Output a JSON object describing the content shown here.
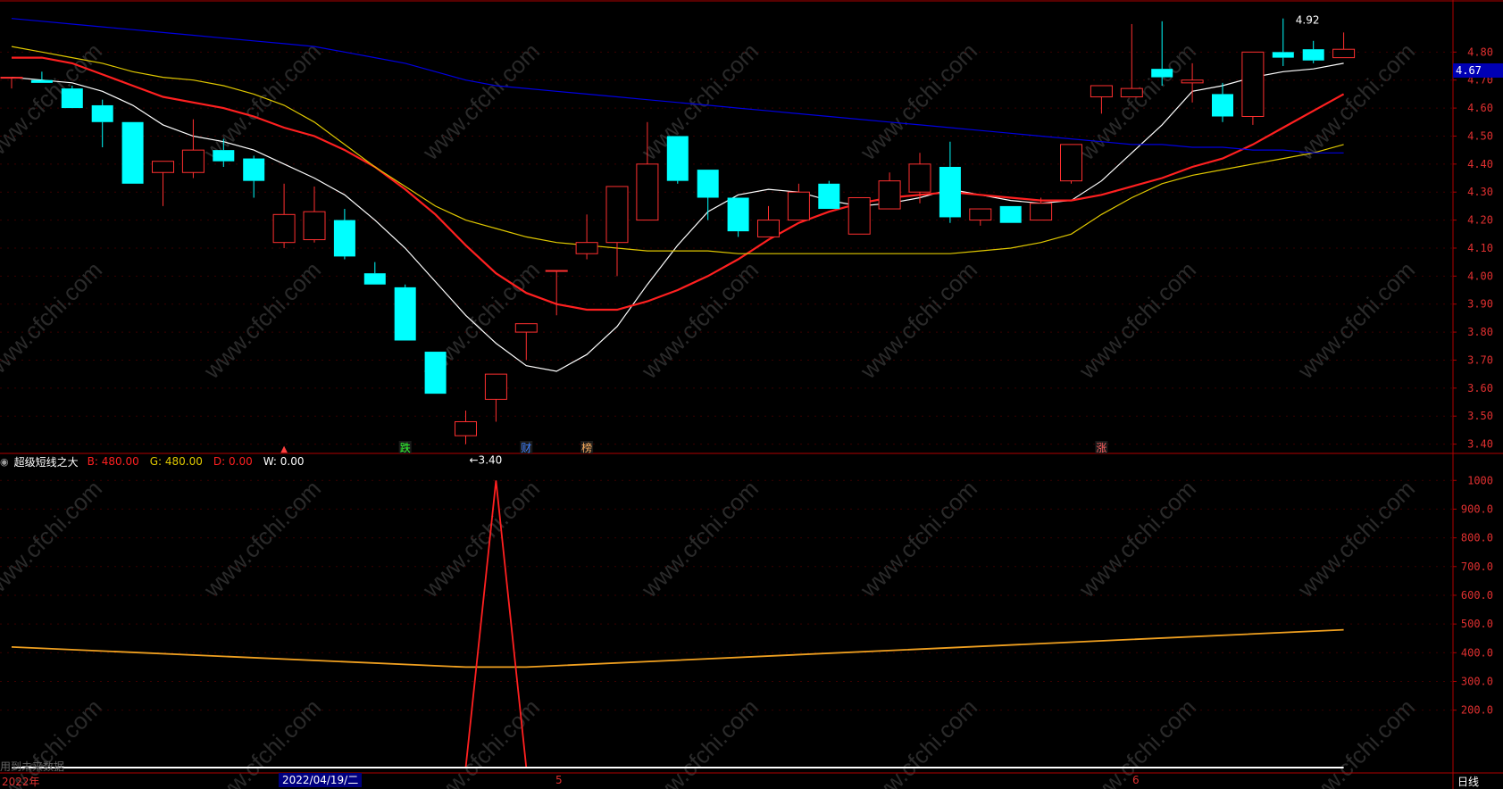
{
  "chart_data": [
    {
      "type": "candlestick",
      "title": "",
      "price_axis": {
        "ticks": [
          "4.80",
          "4.70",
          "4.60",
          "4.50",
          "4.40",
          "4.30",
          "4.20",
          "4.10",
          "4.00",
          "3.90",
          "3.80",
          "3.70",
          "3.60",
          "3.50",
          "3.40"
        ],
        "ylim": [
          3.37,
          4.97
        ]
      },
      "candles": [
        {
          "o": 4.71,
          "h": 4.71,
          "l": 4.67,
          "c": 4.71
        },
        {
          "o": 4.7,
          "h": 4.73,
          "l": 4.69,
          "c": 4.69
        },
        {
          "o": 4.67,
          "h": 4.68,
          "l": 4.6,
          "c": 4.6
        },
        {
          "o": 4.61,
          "h": 4.63,
          "l": 4.46,
          "c": 4.55
        },
        {
          "o": 4.55,
          "h": 4.55,
          "l": 4.33,
          "c": 4.33
        },
        {
          "o": 4.37,
          "h": 4.41,
          "l": 4.25,
          "c": 4.41
        },
        {
          "o": 4.37,
          "h": 4.56,
          "l": 4.35,
          "c": 4.45
        },
        {
          "o": 4.45,
          "h": 4.49,
          "l": 4.39,
          "c": 4.41
        },
        {
          "o": 4.42,
          "h": 4.43,
          "l": 4.28,
          "c": 4.34
        },
        {
          "o": 4.12,
          "h": 4.33,
          "l": 4.1,
          "c": 4.22
        },
        {
          "o": 4.13,
          "h": 4.32,
          "l": 4.12,
          "c": 4.23
        },
        {
          "o": 4.2,
          "h": 4.24,
          "l": 4.06,
          "c": 4.07
        },
        {
          "o": 4.01,
          "h": 4.05,
          "l": 3.97,
          "c": 3.97
        },
        {
          "o": 3.96,
          "h": 3.97,
          "l": 3.77,
          "c": 3.77
        },
        {
          "o": 3.73,
          "h": 3.73,
          "l": 3.58,
          "c": 3.58
        },
        {
          "o": 3.43,
          "h": 3.52,
          "l": 3.4,
          "c": 3.48
        },
        {
          "o": 3.56,
          "h": 3.65,
          "l": 3.48,
          "c": 3.65
        },
        {
          "o": 3.8,
          "h": 3.83,
          "l": 3.7,
          "c": 3.83
        },
        {
          "o": 4.02,
          "h": 4.02,
          "l": 3.86,
          "c": 4.02
        },
        {
          "o": 4.08,
          "h": 4.22,
          "l": 4.06,
          "c": 4.12
        },
        {
          "o": 4.12,
          "h": 4.32,
          "l": 4.0,
          "c": 4.32
        },
        {
          "o": 4.2,
          "h": 4.55,
          "l": 4.2,
          "c": 4.4
        },
        {
          "o": 4.5,
          "h": 4.5,
          "l": 4.33,
          "c": 4.34
        },
        {
          "o": 4.38,
          "h": 4.38,
          "l": 4.2,
          "c": 4.28
        },
        {
          "o": 4.28,
          "h": 4.28,
          "l": 4.14,
          "c": 4.16
        },
        {
          "o": 4.14,
          "h": 4.25,
          "l": 4.14,
          "c": 4.2
        },
        {
          "o": 4.2,
          "h": 4.33,
          "l": 4.2,
          "c": 4.3
        },
        {
          "o": 4.33,
          "h": 4.34,
          "l": 4.24,
          "c": 4.24
        },
        {
          "o": 4.15,
          "h": 4.28,
          "l": 4.15,
          "c": 4.28
        },
        {
          "o": 4.24,
          "h": 4.37,
          "l": 4.24,
          "c": 4.34
        },
        {
          "o": 4.3,
          "h": 4.44,
          "l": 4.26,
          "c": 4.4
        },
        {
          "o": 4.39,
          "h": 4.48,
          "l": 4.19,
          "c": 4.21
        },
        {
          "o": 4.2,
          "h": 4.24,
          "l": 4.18,
          "c": 4.24
        },
        {
          "o": 4.25,
          "h": 4.25,
          "l": 4.19,
          "c": 4.19
        },
        {
          "o": 4.2,
          "h": 4.28,
          "l": 4.2,
          "c": 4.26
        },
        {
          "o": 4.34,
          "h": 4.47,
          "l": 4.33,
          "c": 4.47
        },
        {
          "o": 4.64,
          "h": 4.68,
          "l": 4.58,
          "c": 4.68
        },
        {
          "o": 4.64,
          "h": 4.9,
          "l": 4.64,
          "c": 4.67
        },
        {
          "o": 4.74,
          "h": 4.91,
          "l": 4.68,
          "c": 4.71
        },
        {
          "o": 4.69,
          "h": 4.76,
          "l": 4.62,
          "c": 4.7
        },
        {
          "o": 4.65,
          "h": 4.69,
          "l": 4.55,
          "c": 4.57
        },
        {
          "o": 4.57,
          "h": 4.8,
          "l": 4.54,
          "c": 4.8
        },
        {
          "o": 4.8,
          "h": 4.92,
          "l": 4.75,
          "c": 4.78
        },
        {
          "o": 4.81,
          "h": 4.84,
          "l": 4.76,
          "c": 4.77
        },
        {
          "o": 4.78,
          "h": 4.87,
          "l": 4.78,
          "c": 4.81
        }
      ],
      "ma_lines": [
        {
          "color": "#ffffff",
          "values": [
            4.71,
            4.7,
            4.69,
            4.66,
            4.61,
            4.54,
            4.5,
            4.48,
            4.45,
            4.4,
            4.35,
            4.29,
            4.2,
            4.1,
            3.98,
            3.86,
            3.76,
            3.68,
            3.66,
            3.72,
            3.82,
            3.97,
            4.11,
            4.23,
            4.29,
            4.31,
            4.3,
            4.27,
            4.25,
            4.26,
            4.28,
            4.31,
            4.29,
            4.27,
            4.26,
            4.27,
            4.34,
            4.44,
            4.54,
            4.66,
            4.68,
            4.71,
            4.73,
            4.74,
            4.76
          ]
        },
        {
          "color": "#ff2020",
          "values": [
            4.78,
            4.78,
            4.76,
            4.72,
            4.68,
            4.64,
            4.62,
            4.6,
            4.57,
            4.53,
            4.5,
            4.45,
            4.39,
            4.31,
            4.22,
            4.11,
            4.01,
            3.94,
            3.9,
            3.88,
            3.88,
            3.91,
            3.95,
            4.0,
            4.06,
            4.13,
            4.19,
            4.23,
            4.26,
            4.28,
            4.29,
            4.3,
            4.29,
            4.28,
            4.27,
            4.27,
            4.29,
            4.32,
            4.35,
            4.39,
            4.42,
            4.47,
            4.53,
            4.59,
            4.65
          ]
        },
        {
          "color": "#e0c800",
          "values": [
            4.82,
            4.8,
            4.78,
            4.76,
            4.73,
            4.71,
            4.7,
            4.68,
            4.65,
            4.61,
            4.55,
            4.47,
            4.39,
            4.32,
            4.25,
            4.2,
            4.17,
            4.14,
            4.12,
            4.11,
            4.1,
            4.09,
            4.09,
            4.09,
            4.08,
            4.08,
            4.08,
            4.08,
            4.08,
            4.08,
            4.08,
            4.08,
            4.09,
            4.1,
            4.12,
            4.15,
            4.22,
            4.28,
            4.33,
            4.36,
            4.38,
            4.4,
            4.42,
            4.44,
            4.47
          ]
        },
        {
          "color": "#0000e0",
          "values": [
            4.92,
            4.91,
            4.9,
            4.89,
            4.88,
            4.87,
            4.86,
            4.85,
            4.84,
            4.83,
            4.82,
            4.8,
            4.78,
            4.76,
            4.73,
            4.7,
            4.68,
            4.67,
            4.66,
            4.65,
            4.64,
            4.63,
            4.62,
            4.61,
            4.6,
            4.59,
            4.58,
            4.57,
            4.56,
            4.55,
            4.54,
            4.53,
            4.52,
            4.51,
            4.5,
            4.49,
            4.48,
            4.47,
            4.47,
            4.46,
            4.46,
            4.45,
            4.45,
            4.44,
            4.44
          ]
        }
      ],
      "annotations": {
        "low": "←3.40",
        "high": "4.92",
        "last_price": "4.67"
      },
      "event_markers": [
        "跌",
        "财",
        "榜",
        "涨"
      ]
    },
    {
      "type": "line",
      "title": "超级短线之大",
      "legend": [
        {
          "name": "B:",
          "value": "480.00",
          "color": "#ff2020"
        },
        {
          "name": "G:",
          "value": "480.00",
          "color": "#e0c800"
        },
        {
          "name": "D:",
          "value": "0.00",
          "color": "#ff2020"
        },
        {
          "name": "W:",
          "value": "0.00",
          "color": "#ffffff"
        }
      ],
      "y_ticks": [
        "1000",
        "900.0",
        "800.0",
        "700.0",
        "600.0",
        "500.0",
        "400.0",
        "300.0",
        "200.0"
      ],
      "ylim": [
        0,
        1035
      ],
      "x": [
        0,
        16,
        44
      ],
      "series": [
        {
          "name": "G",
          "color": "#f0a020",
          "x": [
            0,
            15,
            17,
            44
          ],
          "values": [
            420,
            350,
            350,
            480
          ]
        },
        {
          "name": "B",
          "color": "#ff2020",
          "x": [
            15,
            16,
            17
          ],
          "values": [
            0,
            1000,
            0
          ]
        },
        {
          "name": "W",
          "color": "#ffffff",
          "x": [
            0,
            44
          ],
          "values": [
            0,
            0
          ]
        }
      ]
    }
  ],
  "bottom_bar": {
    "year_label": "2022年",
    "cursor_date": "2022/04/19/二",
    "month5": "5",
    "month6": "6",
    "period": "日线"
  },
  "notes": {
    "future_data": "用到未来数据"
  },
  "watermark": "www.cfchi.com"
}
